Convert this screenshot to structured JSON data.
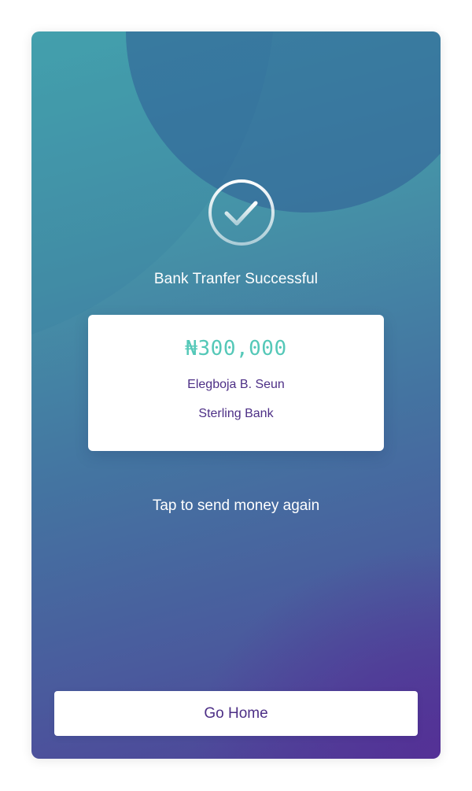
{
  "status": {
    "icon": "check-circle-icon",
    "title": "Bank Tranfer Successful"
  },
  "transfer": {
    "amount": "₦300,000",
    "recipient_name": "Elegboja B. Seun",
    "bank_name": "Sterling Bank"
  },
  "actions": {
    "send_again_label": "Tap to send money again",
    "go_home_label": "Go Home"
  },
  "colors": {
    "amount": "#55c8b8",
    "text_primary": "#4d2f86",
    "gradient_top": "#47a9b0",
    "gradient_bottom": "#4f3f98"
  }
}
